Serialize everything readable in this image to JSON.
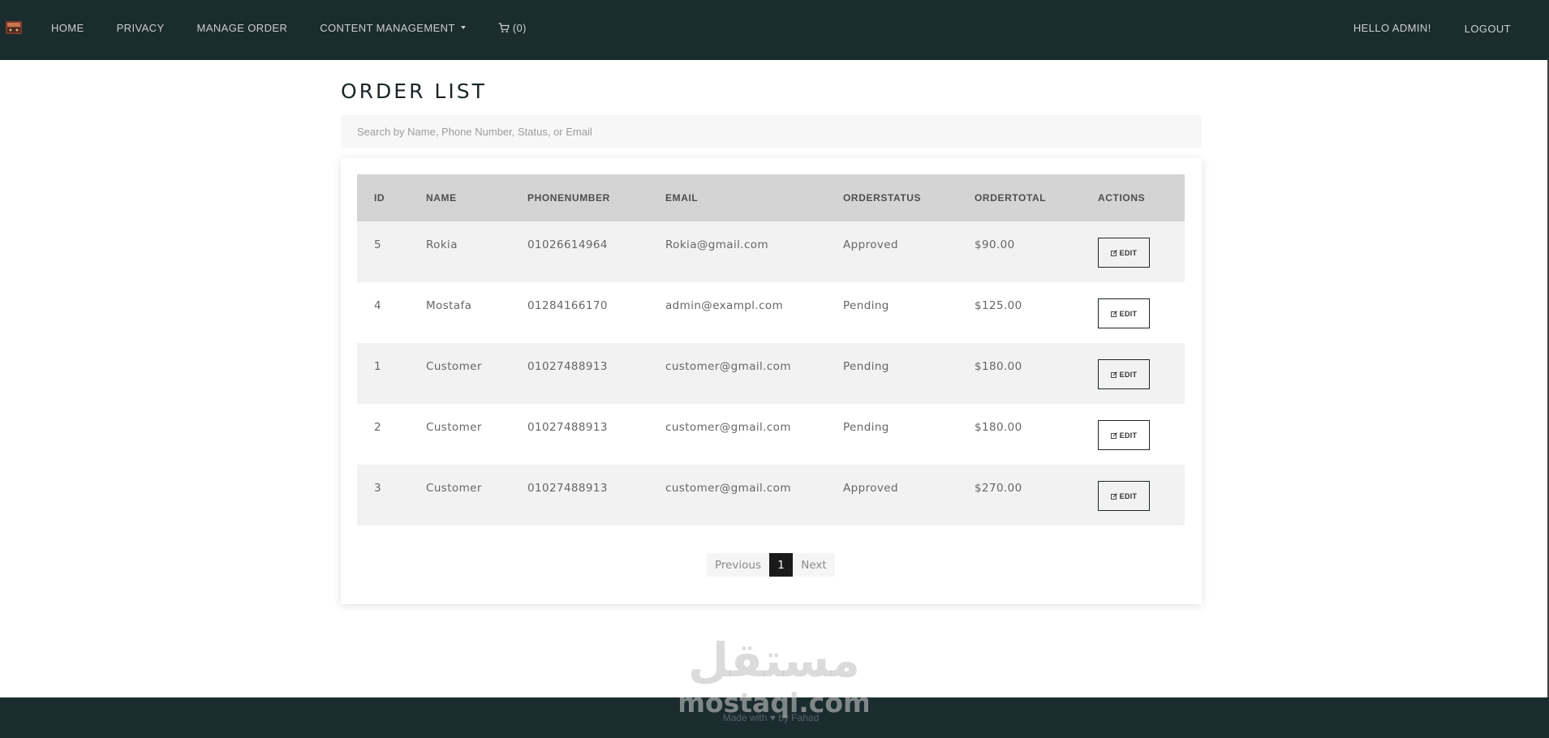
{
  "nav": {
    "items": [
      {
        "label": "HOME"
      },
      {
        "label": "PRIVACY"
      },
      {
        "label": "MANAGE ORDER"
      },
      {
        "label": "CONTENT MANAGEMENT"
      }
    ],
    "cart_label": "(0)",
    "greeting": "HELLO ADMIN!",
    "logout_label": "LOGOUT",
    "background": "#1b2c2e"
  },
  "page": {
    "title": "ORDER LIST",
    "search_placeholder": "Search by Name, Phone Number, Status, or Email"
  },
  "table": {
    "headers": [
      "ID",
      "NAME",
      "PHONENUMBER",
      "EMAIL",
      "ORDERSTATUS",
      "ORDERTOTAL",
      "ACTIONS"
    ],
    "rows": [
      {
        "id": "5",
        "name": "Rokia",
        "phone": "01026614964",
        "email": "Rokia@gmail.com",
        "status": "Approved",
        "total": "$90.00"
      },
      {
        "id": "4",
        "name": "Mostafa",
        "phone": "01284166170",
        "email": "admin@exampl.com",
        "status": "Pending",
        "total": "$125.00"
      },
      {
        "id": "1",
        "name": "Customer",
        "phone": "01027488913",
        "email": "customer@gmail.com",
        "status": "Pending",
        "total": "$180.00"
      },
      {
        "id": "2",
        "name": "Customer",
        "phone": "01027488913",
        "email": "customer@gmail.com",
        "status": "Pending",
        "total": "$180.00"
      },
      {
        "id": "3",
        "name": "Customer",
        "phone": "01027488913",
        "email": "customer@gmail.com",
        "status": "Approved",
        "total": "$270.00"
      }
    ],
    "edit_label": "EDIT"
  },
  "pagination": {
    "previous": "Previous",
    "current": "1",
    "next": "Next"
  },
  "footer": {
    "text": "Made with ♥ by Fahad"
  },
  "watermark": {
    "arabic": "مستقل",
    "latin": "mostaql.com"
  }
}
